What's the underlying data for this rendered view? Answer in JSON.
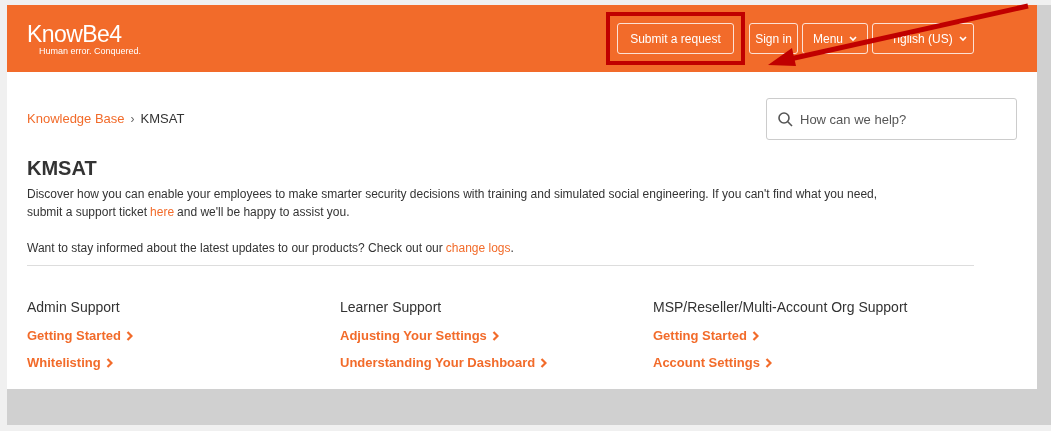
{
  "header": {
    "logo": "KnowBe4",
    "tagline": "Human error. Conquered.",
    "buttons": [
      {
        "label": "Submit a request",
        "kind": "button",
        "highlighted": true
      },
      {
        "label": "Sign in",
        "kind": "button",
        "highlighted": false
      },
      {
        "label": "Menu",
        "kind": "dropdown",
        "highlighted": false
      },
      {
        "label": "nglish (US)",
        "kind": "dropdown",
        "highlighted": false
      }
    ]
  },
  "breadcrumb": [
    {
      "label": "Knowledge Base",
      "kind": "link"
    },
    {
      "label": "›",
      "kind": "separator"
    },
    {
      "label": "KMSAT",
      "kind": "current"
    }
  ],
  "search": {
    "placeholder": "How can we help?"
  },
  "title": "KMSAT",
  "description": [
    [
      [
        {
          "text": "Discover how you can enable your employees to make smarter security decisions with training and simulated social engineering. If you can't find what you need,",
          "kind": "text"
        }
      ],
      [
        {
          "text": "submit a support ticket",
          "kind": "text"
        },
        {
          "text": "here",
          "kind": "link"
        },
        {
          "text": "and we'll be happy to assist you.",
          "kind": "text"
        }
      ]
    ],
    [
      [
        {
          "text": "Want to stay informed about the latest updates to our products? Check out our",
          "kind": "text"
        },
        {
          "text": "change logs",
          "kind": "link"
        },
        {
          "text": ".",
          "kind": "punct"
        }
      ]
    ]
  ],
  "sections": [
    {
      "heading": "Admin Support",
      "links": [
        "Getting Started",
        "Whitelisting"
      ]
    },
    {
      "heading": "Learner Support",
      "links": [
        "Adjusting Your Settings",
        "Understanding Your Dashboard"
      ]
    },
    {
      "heading": "MSP/Reseller/Multi-Account Org Support",
      "links": [
        "Getting Started",
        "Account Settings"
      ]
    }
  ]
}
